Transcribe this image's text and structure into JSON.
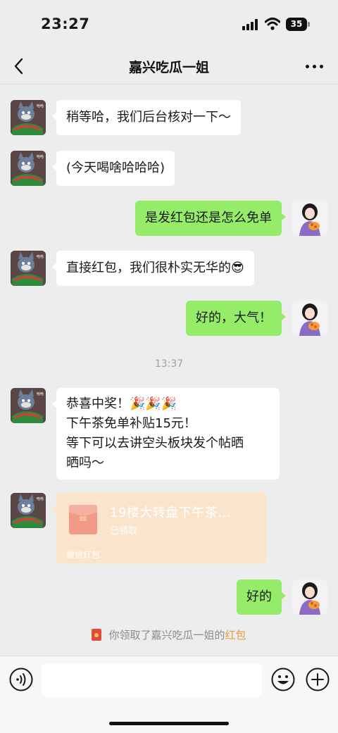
{
  "status_bar": {
    "time": "23:27",
    "battery": "35"
  },
  "header": {
    "title": "嘉兴吃瓜一姐"
  },
  "messages": [
    {
      "side": "left",
      "text": "稍等哈，我们后台核对一下～"
    },
    {
      "side": "left",
      "text": "(今天喝啥哈哈哈)"
    },
    {
      "side": "right",
      "text": "是发红包还是怎么免单"
    },
    {
      "side": "left",
      "text": "直接红包，我们很朴实无华的😎"
    },
    {
      "side": "right",
      "text": "好的，大气！"
    },
    {
      "side": "left",
      "text": "恭喜中奖！🎉🎉🎉\n下午茶免单补贴15元！\n等下可以去讲空头板块发个帖晒\n晒吗～"
    },
    {
      "side": "right",
      "text": "好的"
    }
  ],
  "timestamp": "13:37",
  "red_packet": {
    "title": "19楼大转盘下午茶...",
    "status": "已领取",
    "footer": "微信红包"
  },
  "system_message": {
    "prefix": "你领取了嘉兴吃瓜一姐的",
    "link": "红包"
  },
  "input_bar": {
    "placeholder": ""
  },
  "colors": {
    "background": "#EDEDED",
    "bubble_self": "#95EC69",
    "bubble_other": "#FFFFFF",
    "red_packet_claimed": "#FAE4CB",
    "link_orange": "#E89A3D"
  }
}
